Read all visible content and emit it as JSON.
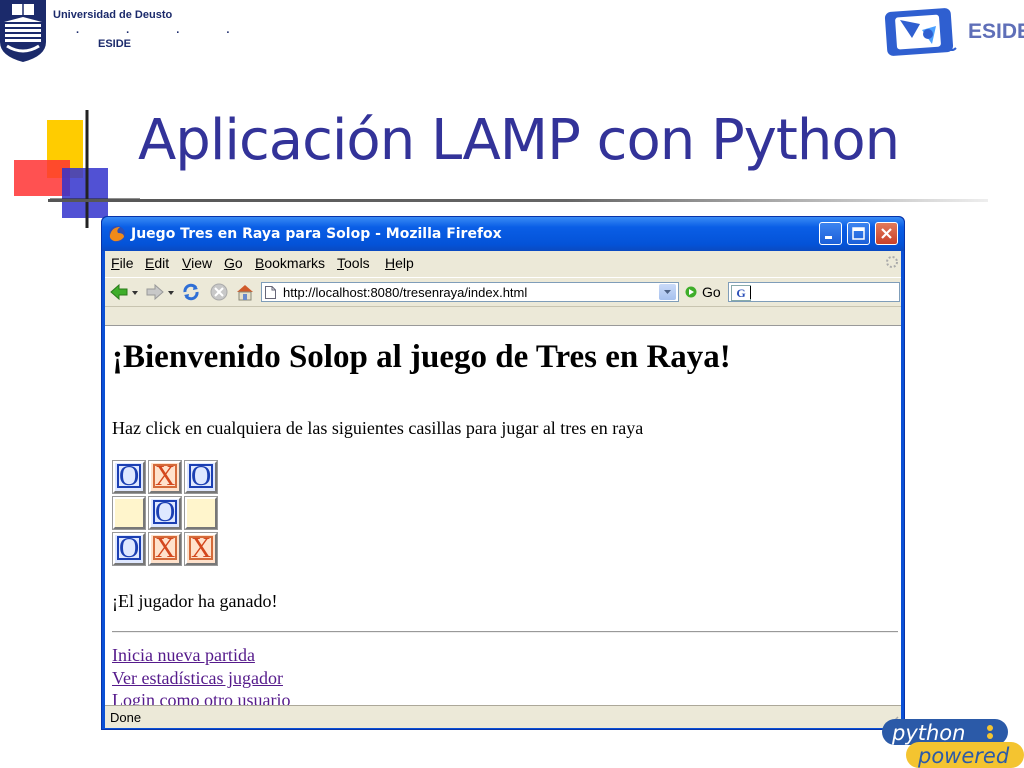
{
  "slide": {
    "title": "Aplicación LAMP con Python",
    "university_name": "Universidad de Deusto",
    "university_dots": ". . . .",
    "university_school": "ESIDE",
    "event_logo_text": "ESIDE",
    "python_logo_line1": "python",
    "python_logo_line2": "powered",
    "colors": {
      "title": "#333399",
      "accent_yellow": "#ffcc00",
      "accent_red": "#ff3333",
      "accent_blue": "#3333cc"
    }
  },
  "browser": {
    "window_title": "Juego Tres en Raya para Solop - Mozilla Firefox",
    "menu": [
      {
        "label": "File",
        "underline": "F",
        "rest": "ile"
      },
      {
        "label": "Edit",
        "underline": "E",
        "rest": "dit"
      },
      {
        "label": "View",
        "underline": "V",
        "rest": "iew"
      },
      {
        "label": "Go",
        "underline": "G",
        "rest": "o"
      },
      {
        "label": "Bookmarks",
        "underline": "B",
        "rest": "ookmarks"
      },
      {
        "label": "Tools",
        "underline": "T",
        "rest": "ools"
      },
      {
        "label": "Help",
        "underline": "H",
        "rest": "elp"
      }
    ],
    "url": "http://localhost:8080/tresenraya/index.html",
    "go_label": "Go",
    "search_engine_icon": "G",
    "status": "Done"
  },
  "page": {
    "heading": "¡Bienvenido Solop al juego de Tres en Raya!",
    "intro": "Haz click en cualquiera de las siguientes casillas para jugar al tres en raya",
    "board": [
      [
        "O",
        "X",
        "O"
      ],
      [
        "",
        "O",
        ""
      ],
      [
        "O",
        "X",
        "X"
      ]
    ],
    "result": "¡El jugador ha ganado!",
    "links": [
      "Inicia nueva partida",
      "Ver estadísticas jugador",
      "Login como otro usuario"
    ]
  }
}
